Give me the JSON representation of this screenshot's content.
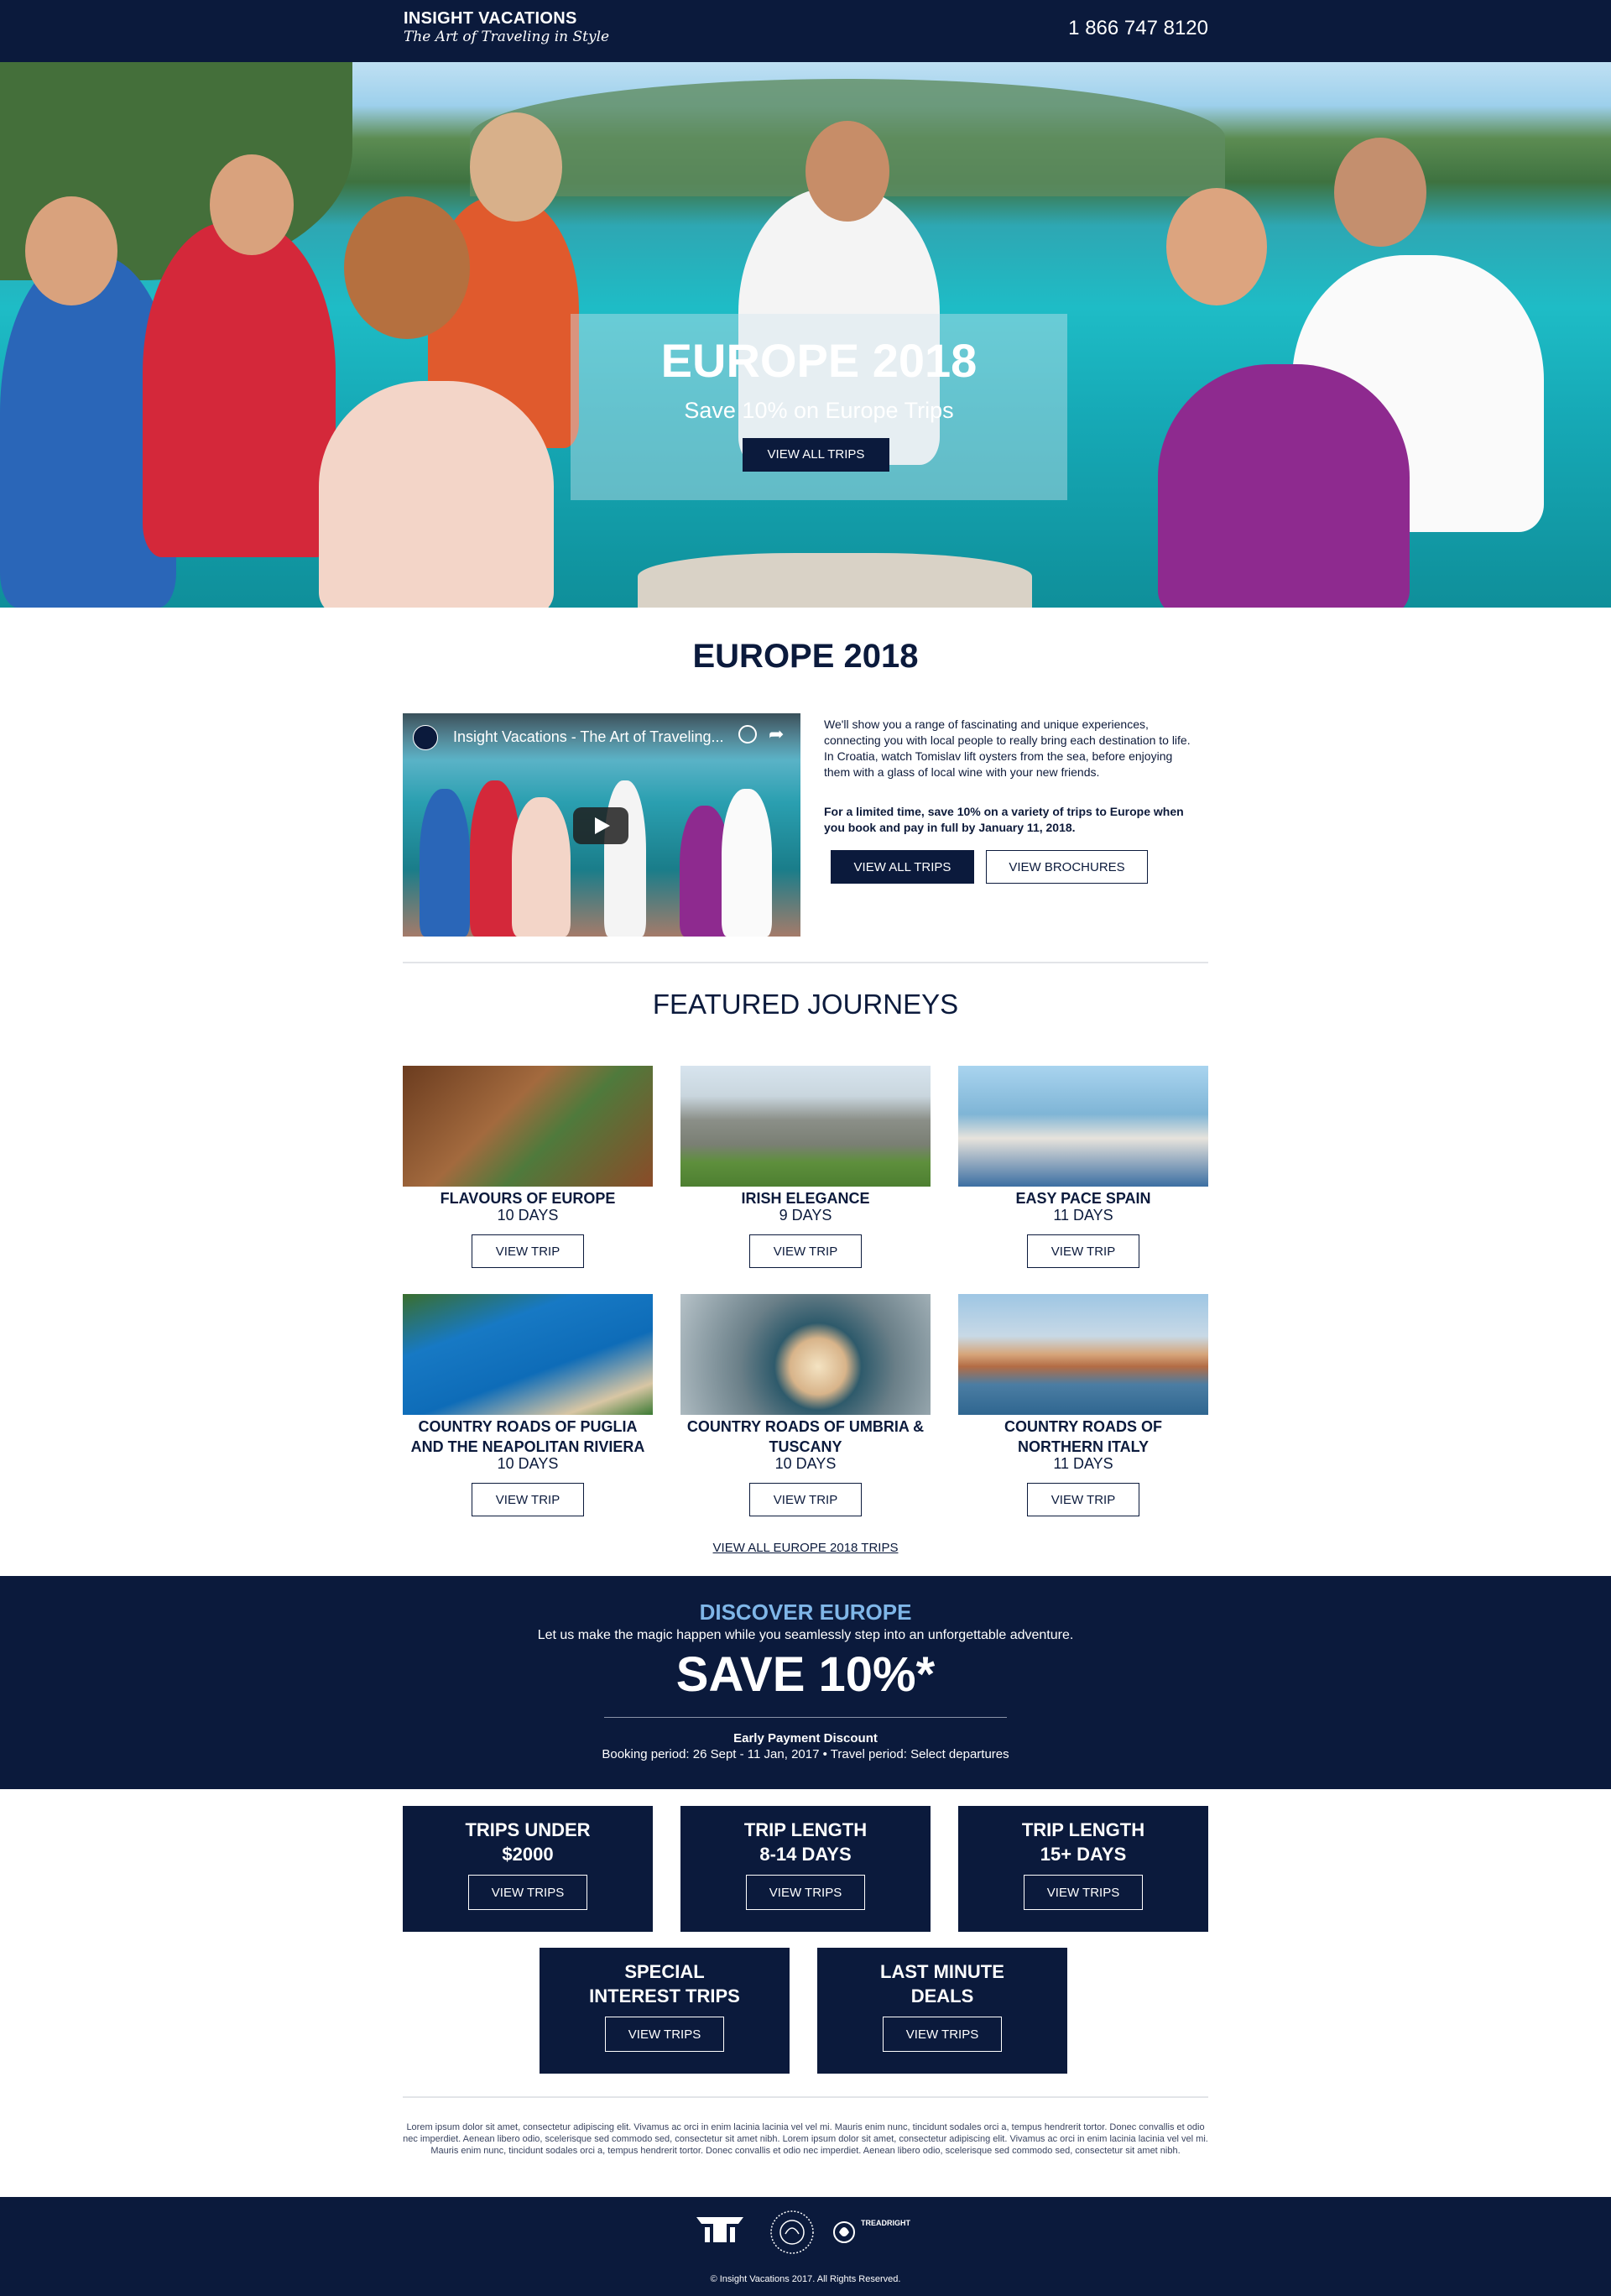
{
  "header": {
    "brand_name": "INSIGHT VACATIONS",
    "brand_tagline": "The Art of Traveling in Style",
    "phone": "1 866 747 8120"
  },
  "hero": {
    "title": "EUROPE 2018",
    "subtitle": "Save 10% on Europe Trips",
    "button_label": "VIEW ALL TRIPS"
  },
  "intro": {
    "section_title": "EUROPE 2018",
    "video_title": "Insight Vacations - The Art of Traveling...",
    "paragraph": "We'll show you a range of fascinating and unique experiences, connecting you with local people to really bring each destination to life. In Croatia, watch Tomislav lift oysters from the sea, before enjoying them with a glass of local wine with your new friends.",
    "offer": "For a limited time, save 10% on a variety of trips to Europe when you book and pay in full by January 11, 2018.",
    "btn_all_trips": "VIEW ALL TRIPS",
    "btn_brochures": "VIEW BROCHURES"
  },
  "featured": {
    "title": "FEATURED JOURNEYS",
    "cards": [
      {
        "name_lines": [
          "FLAVOURS OF EUROPE"
        ],
        "days": "10 DAYS",
        "button": "VIEW TRIP",
        "image": "food-table-image"
      },
      {
        "name_lines": [
          "IRISH ELEGANCE"
        ],
        "days": "9 DAYS",
        "button": "VIEW TRIP",
        "image": "castle-image"
      },
      {
        "name_lines": [
          "EASY PACE SPAIN"
        ],
        "days": "11 DAYS",
        "button": "VIEW TRIP",
        "image": "harbour-couple-image"
      },
      {
        "name_lines": [
          "COUNTRY ROADS OF PUGLIA",
          "AND THE NEAPOLITAN RIVIERA"
        ],
        "days": "10 DAYS",
        "button": "VIEW TRIP",
        "image": "coast-image"
      },
      {
        "name_lines": [
          "COUNTRY ROADS OF UMBRIA &",
          "TUSCANY"
        ],
        "days": "10 DAYS",
        "button": "VIEW TRIP",
        "image": "bowl-dish-image"
      },
      {
        "name_lines": [
          "COUNTRY ROADS OF",
          "NORTHERN ITALY"
        ],
        "days": "11 DAYS",
        "button": "VIEW TRIP",
        "image": "lake-town-image"
      }
    ],
    "view_all_link": "VIEW ALL EUROPE 2018 TRIPS"
  },
  "discover": {
    "title": "DISCOVER EUROPE",
    "subtitle": "Let us make the magic happen while you seamlessly step into an unforgettable adventure.",
    "save": "SAVE 10%*",
    "label": "Early Payment Discount",
    "detail": "Booking period: 26 Sept - 11 Jan, 2017 • Travel period: Select departures"
  },
  "tiles": [
    {
      "line1": "TRIPS UNDER",
      "line2": "$2000",
      "button": "VIEW TRIPS"
    },
    {
      "line1": "TRIP LENGTH",
      "line2": "8-14 DAYS",
      "button": "VIEW TRIPS"
    },
    {
      "line1": "TRIP LENGTH",
      "line2": "15+ DAYS",
      "button": "VIEW TRIPS"
    },
    {
      "line1": "SPECIAL",
      "line2": "INTEREST TRIPS",
      "button": "VIEW TRIPS"
    },
    {
      "line1": "LAST MINUTE",
      "line2": "DEALS",
      "button": "VIEW TRIPS"
    }
  ],
  "legal": {
    "lorem": "Lorem ipsum dolor sit amet, consectetur adipiscing elit. Vivamus ac orci in enim lacinia lacinia vel vel mi. Mauris enim nunc, tincidunt sodales orci a, tempus hendrerit tortor. Donec convallis et odio nec imperdiet. Aenean libero odio, scelerisque sed commodo sed, consectetur sit amet nibh. Lorem ipsum dolor sit amet, consectetur adipiscing elit. Vivamus ac orci in enim lacinia lacinia vel vel mi. Mauris enim nunc, tincidunt sodales orci a, tempus hendrerit tortor. Donec convallis et odio nec imperdiet. Aenean libero odio, scelerisque sed commodo sed, consectetur sit amet nibh."
  },
  "footer": {
    "logos": [
      "insight-crest-logo",
      "family-of-brands-seal-logo",
      "treadright-logo"
    ],
    "treadright_text": "TREADRIGHT",
    "copyright": "© Insight Vacations 2017. All Rights Reserved."
  },
  "colors": {
    "navy": "#0b1a3c",
    "accent_blue": "#7fb6e8",
    "white": "#ffffff"
  }
}
